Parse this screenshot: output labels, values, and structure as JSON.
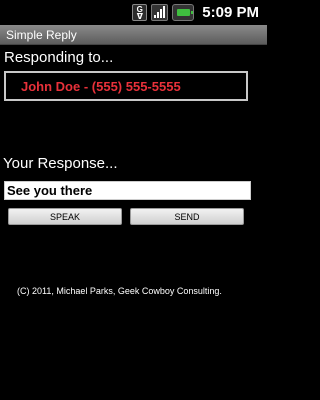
{
  "status_bar": {
    "time": "5:09 PM",
    "icons": [
      "gmail-notification-icon",
      "signal-icon",
      "battery-icon"
    ]
  },
  "app": {
    "title": "Simple Reply"
  },
  "responding": {
    "label": "Responding to...",
    "contact": "John Doe - (555) 555-5555"
  },
  "response": {
    "label": "Your Response...",
    "value": "See you there"
  },
  "buttons": {
    "speak": "SPEAK",
    "send": "SEND"
  },
  "footer": {
    "copyright": "(C) 2011, Michael Parks, Geek Cowboy Consulting."
  },
  "colors": {
    "contact_text": "#e8313a",
    "background": "#000000"
  }
}
